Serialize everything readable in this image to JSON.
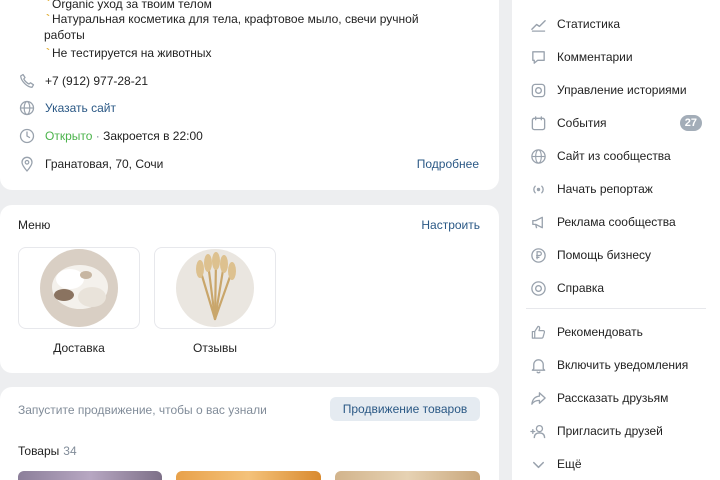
{
  "description": {
    "lines": [
      "Organic уход за твоим телом",
      "Натуральная косметика для тела, крафтовое мыло, свечи ручной",
      "работы",
      "Не тестируется на животных"
    ]
  },
  "contacts": {
    "phone": "+7 (912) 977-28-21",
    "site": "Указать сайт",
    "hours_status": "Открыто",
    "hours_sep": " · ",
    "hours_detail": "Закроется в 22:00",
    "address": "Гранатовая, 70, Сочи",
    "more_link": "Подробнее"
  },
  "menu": {
    "title": "Меню",
    "action": "Настроить",
    "items": [
      {
        "label": "Доставка"
      },
      {
        "label": "Отзывы"
      }
    ]
  },
  "promo": {
    "text": "Запустите продвижение, чтобы о вас узнали",
    "button": "Продвижение товаров",
    "goods_title": "Товары",
    "goods_count": "34"
  },
  "sidebar": {
    "items": [
      {
        "label": "Статистика",
        "icon": "chart-icon"
      },
      {
        "label": "Комментарии",
        "icon": "comment-icon"
      },
      {
        "label": "Управление историями",
        "icon": "stories-icon"
      },
      {
        "label": "События",
        "icon": "calendar-icon",
        "badge": "27"
      },
      {
        "label": "Сайт из сообщества",
        "icon": "globe-icon"
      },
      {
        "label": "Начать репортаж",
        "icon": "live-icon"
      },
      {
        "label": "Реклама сообщества",
        "icon": "megaphone-icon"
      },
      {
        "label": "Помощь бизнесу",
        "icon": "ruble-icon"
      },
      {
        "label": "Справка",
        "icon": "help-icon"
      },
      {
        "label": "Рекомендовать",
        "icon": "like-icon"
      },
      {
        "label": "Включить уведомления",
        "icon": "bell-icon"
      },
      {
        "label": "Рассказать друзьям",
        "icon": "share-icon"
      },
      {
        "label": "Пригласить друзей",
        "icon": "add-user-icon"
      },
      {
        "label": "Ещё",
        "icon": "chevron-down-icon"
      }
    ]
  },
  "colors": {
    "accent": "#2a5885",
    "open": "#4bb34b",
    "muted": "#818c99",
    "background": "#edeef0"
  }
}
